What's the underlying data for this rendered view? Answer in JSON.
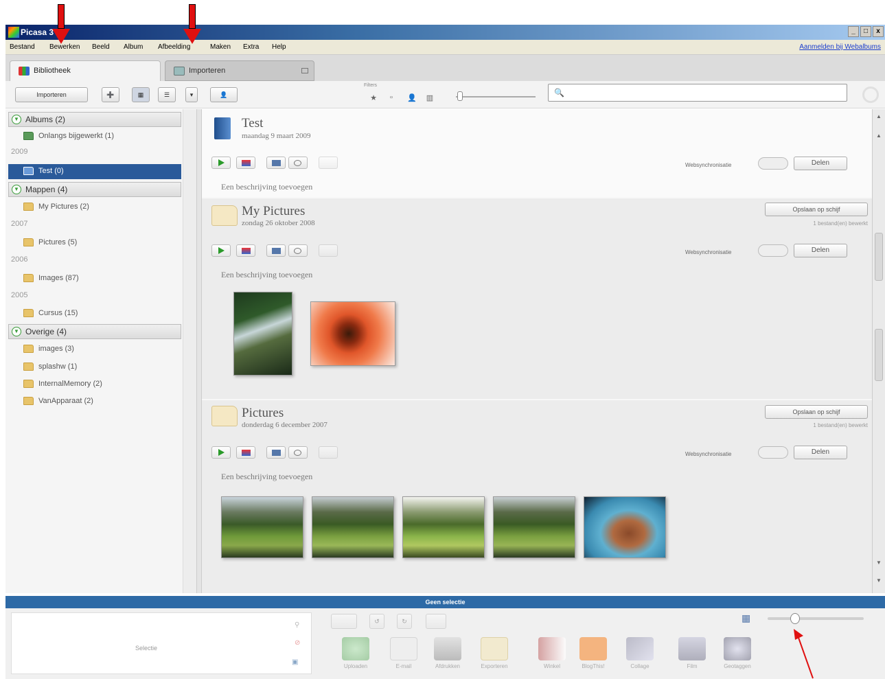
{
  "window": {
    "title": "Picasa 3",
    "controls": [
      "_",
      "□",
      "x"
    ]
  },
  "menu": {
    "items": [
      "Bestand",
      "Bewerken",
      "Beeld",
      "Album",
      "Afbeelding",
      "Maken",
      "Extra",
      "Help"
    ],
    "signin": "Aanmelden bij Webalbums"
  },
  "tabs": [
    {
      "label": "Bibliotheek",
      "active": true
    },
    {
      "label": "Importeren",
      "active": false
    }
  ],
  "toolbar": {
    "import_label": "Importeren",
    "filters_label": "Filters",
    "search_placeholder": ""
  },
  "sidebar": {
    "groups": [
      {
        "label": "Albums (2)"
      },
      {
        "label": "Mappen (4)"
      },
      {
        "label": "Overige (4)"
      }
    ],
    "items": [
      {
        "label": "Onlangs bijgewerkt (1)"
      },
      {
        "label": "Test (0)",
        "selected": true
      },
      {
        "label": "My Pictures (2)"
      },
      {
        "label": "Pictures (5)"
      },
      {
        "label": "Images (87)"
      },
      {
        "label": "Cursus (15)"
      },
      {
        "label": "images (3)"
      },
      {
        "label": "splashw (1)"
      },
      {
        "label": "InternalMemory (2)"
      },
      {
        "label": "VanApparaat (2)"
      }
    ],
    "years": [
      "2009",
      "2007",
      "2006",
      "2005"
    ]
  },
  "sections": [
    {
      "title": "Test",
      "date": "maandag 9 maart 2009",
      "sync": "Websynchronisatie",
      "share": "Delen",
      "description": "Een beschrijving toevoegen"
    },
    {
      "title": "My Pictures",
      "date": "zondag 26 oktober 2008",
      "save": "Opslaan op schijf",
      "save_note": "1 bestand(en) bewerkt",
      "sync": "Websynchronisatie",
      "share": "Delen",
      "description": "Een beschrijving toevoegen"
    },
    {
      "title": "Pictures",
      "date": "donderdag 6 december 2007",
      "save": "Opslaan op schijf",
      "save_note": "1 bestand(en) bewerkt",
      "sync": "Websynchronisatie",
      "share": "Delen",
      "description": "Een beschrijving toevoegen"
    }
  ],
  "bottom": {
    "status": "Geen selectie",
    "selection_label": "Selectie",
    "actions": [
      "Uploaden",
      "E-mail",
      "Afdrukken",
      "Exporteren",
      "Winkel",
      "BlogThis!",
      "Collage",
      "Film",
      "Geotaggen"
    ]
  },
  "colors": {
    "accent": "#2e6aa6",
    "selected": "#2a5a9a",
    "annotation": "#e01010"
  }
}
